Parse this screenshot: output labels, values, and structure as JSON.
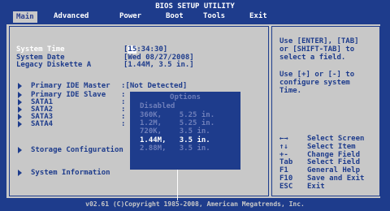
{
  "title": "BIOS SETUP UTILITY",
  "menu": [
    "Main",
    "Advanced",
    "Power",
    "Boot",
    "Tools",
    "Exit"
  ],
  "fields": {
    "time_label": "System Time",
    "time_value_prefix": "[",
    "time_cursor": "15",
    "time_value_rest": ":34:30]",
    "date_label": "System Date",
    "date_value": "[Wed 08/27/2008]",
    "diskette_label": "Legacy Diskette A",
    "diskette_value": "[1.44M, 3.5 in.]"
  },
  "submenus": [
    {
      "label": "Primary IDE Master",
      "value": ":[Not Detected]"
    },
    {
      "label": "Primary IDE Slave",
      "value": ":"
    },
    {
      "label": "SATA1",
      "value": ":"
    },
    {
      "label": "SATA2",
      "value": ":"
    },
    {
      "label": "SATA3",
      "value": ":"
    },
    {
      "label": "SATA4",
      "value": ":"
    },
    {
      "label": "Storage Configuration",
      "value": ""
    },
    {
      "label": "System Information",
      "value": ""
    }
  ],
  "popup": {
    "title": "Options",
    "options": [
      "Disabled",
      "360K,    5.25 in.",
      "1.2M,    5.25 in.",
      "720K,    3.5 in.",
      "1.44M,   3.5 in.",
      "2.88M,   3.5 in."
    ],
    "selected_index": 4
  },
  "help": {
    "text1": "Use [ENTER], [TAB]",
    "text2": "or [SHIFT-TAB] to",
    "text3": "select a field.",
    "text4": "Use [+] or [-] to",
    "text5": "configure system",
    "text6": "Time."
  },
  "keys": [
    {
      "key": "←→",
      "desc": "Select Screen"
    },
    {
      "key": "↑↓",
      "desc": "Select Item"
    },
    {
      "key": "+-",
      "desc": "Change Field"
    },
    {
      "key": "Tab",
      "desc": "Select Field"
    },
    {
      "key": "F1",
      "desc": "General Help"
    },
    {
      "key": "F10",
      "desc": "Save and Exit"
    },
    {
      "key": "ESC",
      "desc": "Exit"
    }
  ],
  "footer": "v02.61 (C)Copyright 1985-2008, American Megatrends, Inc."
}
